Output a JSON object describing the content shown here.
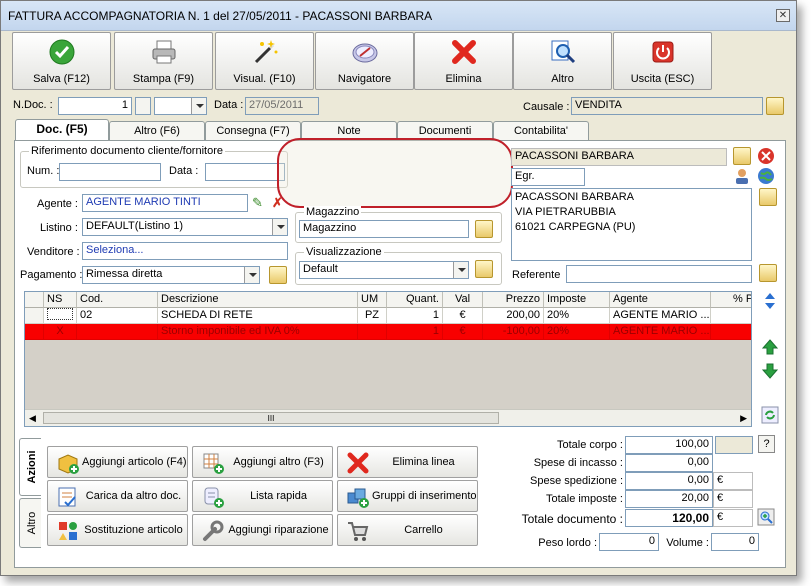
{
  "window": {
    "title": "FATTURA ACCOMPAGNATORIA N. 1  del 27/05/2011  - PACASSONI BARBARA",
    "close": "✕"
  },
  "toolbar": {
    "save": "Salva (F12)",
    "print": "Stampa (F9)",
    "visual": "Visual. (F10)",
    "navigator": "Navigatore",
    "delete": "Elimina",
    "other": "Altro",
    "exit": "Uscita (ESC)"
  },
  "header": {
    "ndoc_label": "N.Doc. :",
    "ndoc_value": "1",
    "data_label": "Data :",
    "data_value": "27/05/2011",
    "causale_label": "Causale :",
    "causale_value": "VENDITA"
  },
  "tabs": [
    "Doc. (F5)",
    "Altro (F6)",
    "Consegna (F7)",
    "Note",
    "Documenti",
    "Contabilita'"
  ],
  "doc": {
    "rif_title": "Riferimento documento cliente/fornitore",
    "num_label": "Num. :",
    "num_value": "",
    "data_label": "Data :",
    "data_value": "",
    "agente_label": "Agente :",
    "agente_value": "AGENTE MARIO TINTI",
    "listino_label": "Listino :",
    "listino_value": "DEFAULT(Listino 1)",
    "venditore_label": "Venditore :",
    "venditore_value": "Seleziona...",
    "pagamento_label": "Pagamento :",
    "pagamento_value": "Rimessa diretta",
    "magazzino_title": "Magazzino",
    "magazzino_value": "Magazzino",
    "visual_title": "Visualizzazione",
    "visual_value": "Default",
    "cliente_name": "PACASSONI BARBARA",
    "cliente_title": "Egr.",
    "address_lines": [
      "PACASSONI BARBARA",
      "VIA PIETRARUBBIA",
      "61021 CARPEGNA (PU)"
    ],
    "referente_label": "Referente",
    "referente_value": ""
  },
  "grid": {
    "headers": [
      "NS",
      "Cod.",
      "Descrizione",
      "UM",
      "Quant.",
      "Val",
      "Prezzo",
      "Imposte",
      "Agente",
      "% Pr"
    ],
    "rows": [
      {
        "ns": "",
        "cod": "02",
        "descr": "SCHEDA DI RETE",
        "um": "PZ",
        "quant": "1",
        "val": "€",
        "prezzo": "200,00",
        "imposte": "20%",
        "agente": "AGENTE MARIO ...",
        "pr": ""
      },
      {
        "ns": "X",
        "cod": "",
        "descr": "Storno imponibile ed IVA 0%",
        "um": "",
        "quant": "1",
        "val": "€",
        "prezzo": "-100,00",
        "imposte": "20%",
        "agente": "AGENTE MARIO ...",
        "pr": ""
      }
    ],
    "scroll_grip": "III"
  },
  "actions": {
    "tab_azioni": "Azioni",
    "tab_altro": "Altro",
    "buttons": [
      "Aggiungi articolo (F4)",
      "Aggiungi altro (F3)",
      "Elimina linea",
      "Carica da altro doc.",
      "Lista rapida",
      "Gruppi di inserimento",
      "Sostituzione articolo",
      "Aggiungi riparazione",
      "Carrello"
    ]
  },
  "totals": {
    "corpo_label": "Totale corpo :",
    "corpo_value": "100,00",
    "incasso_label": "Spese di incasso :",
    "incasso_value": "0,00",
    "spedizione_label": "Spese spedizione :",
    "spedizione_value": "0,00",
    "imposte_label": "Totale imposte :",
    "imposte_value": "20,00",
    "documento_label": "Totale documento :",
    "documento_value": "120,00",
    "currency": "€",
    "help": "?",
    "peso_label": "Peso lordo :",
    "peso_value": "0",
    "volume_label": "Volume :",
    "volume_value": "0"
  },
  "colors": {
    "row_red": "#f80000",
    "highlight_circle": "#c0202a",
    "accent_blue": "#1f3bb3"
  }
}
